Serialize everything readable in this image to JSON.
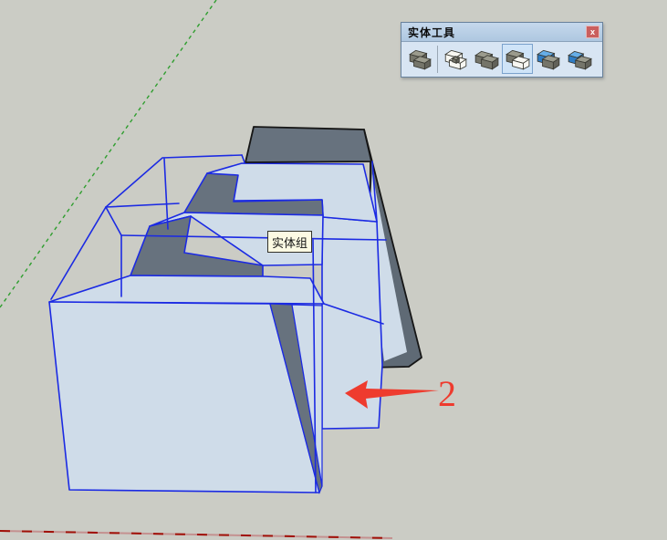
{
  "toolbar": {
    "title": "实体工具",
    "close_glyph": "x",
    "buttons": [
      {
        "name": "outer-shell",
        "selected": false
      },
      {
        "name": "intersect",
        "selected": false
      },
      {
        "name": "union",
        "selected": false
      },
      {
        "name": "subtract",
        "selected": true
      },
      {
        "name": "trim",
        "selected": false
      },
      {
        "name": "split",
        "selected": false
      }
    ]
  },
  "viewport": {
    "tooltip_text": "实体组",
    "annotation_label": "2"
  },
  "colors": {
    "bg": "#cbccc5",
    "face_light": "#cfdce9",
    "face_dark": "#67727e",
    "face_dark_side": "#5f6a75",
    "edge_blue": "#1b2ae3",
    "edge_black": "#161616",
    "axis_green": "#2f9e2f",
    "axis_red_dark": "#a01008",
    "axis_red_light": "#c49190",
    "arrow_red": "#ee3b2e",
    "tooltip_bg": "#fcfae3",
    "tb_body": "#d8e5f3",
    "tb_sel_bg": "#cfe4f8",
    "close_bg": "#ca5f5e"
  }
}
